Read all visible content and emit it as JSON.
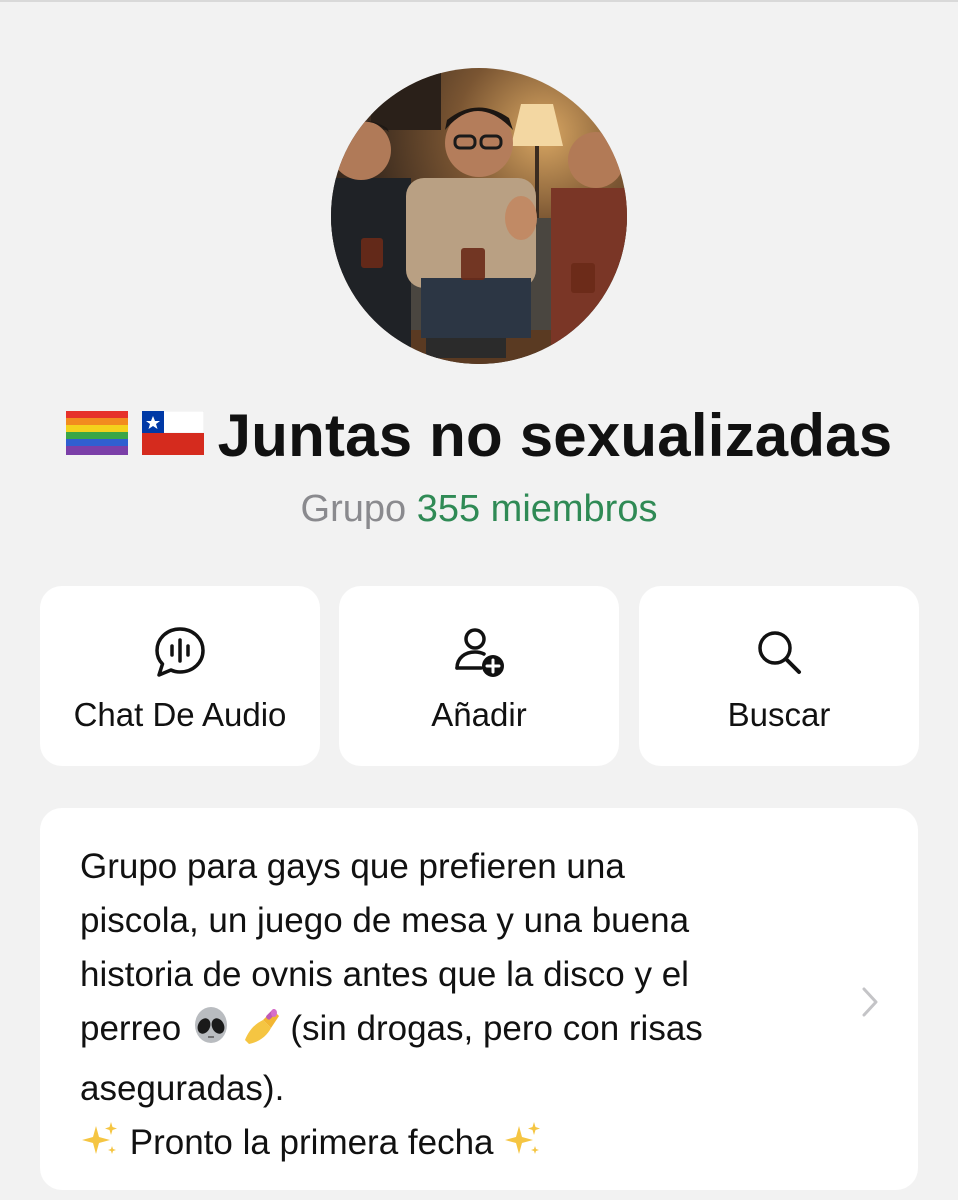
{
  "group": {
    "title": "Juntas no sexualizadas",
    "flags": [
      "rainbow-flag",
      "chile-flag"
    ],
    "type_label": "Grupo",
    "members_label": "355 miembros",
    "colors": {
      "members": "#2f8a55",
      "subtitle": "#8a8a8e",
      "background": "#f2f2f2",
      "card": "#ffffff"
    }
  },
  "actions": [
    {
      "label": "Chat De Audio",
      "icon": "audio-chat-icon"
    },
    {
      "label": "Añadir",
      "icon": "add-person-icon"
    },
    {
      "label": "Buscar",
      "icon": "search-icon"
    }
  ],
  "about": {
    "line1": "Grupo para gays que prefieren una",
    "line2": "piscola, un juego de mesa y una buena",
    "line3": "historia de ovnis antes que la disco y el",
    "line4_a": "perreo",
    "line4_b": "(sin drogas, pero con risas",
    "line5": "aseguradas).",
    "line6": "Pronto la primera fecha",
    "emojis": [
      "alien-emoji",
      "nail-polish-emoji",
      "sparkles-emoji"
    ]
  }
}
